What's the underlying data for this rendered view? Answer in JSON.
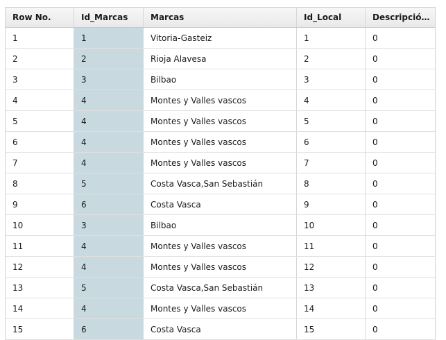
{
  "table": {
    "columns": [
      "Row No.",
      "Id_Marcas",
      "Marcas",
      "Id_Local",
      "Descripció…"
    ],
    "rows": [
      [
        "1",
        "1",
        "Vitoria-Gasteiz",
        "1",
        "0"
      ],
      [
        "2",
        "2",
        "Rioja Alavesa",
        "2",
        "0"
      ],
      [
        "3",
        "3",
        "Bilbao",
        "3",
        "0"
      ],
      [
        "4",
        "4",
        "Montes y Valles vascos",
        "4",
        "0"
      ],
      [
        "5",
        "4",
        "Montes y Valles vascos",
        "5",
        "0"
      ],
      [
        "6",
        "4",
        "Montes y Valles vascos",
        "6",
        "0"
      ],
      [
        "7",
        "4",
        "Montes y Valles vascos",
        "7",
        "0"
      ],
      [
        "8",
        "5",
        "Costa Vasca,San Sebastián",
        "8",
        "0"
      ],
      [
        "9",
        "6",
        "Costa Vasca",
        "9",
        "0"
      ],
      [
        "10",
        "3",
        "Bilbao",
        "10",
        "0"
      ],
      [
        "11",
        "4",
        "Montes y Valles vascos",
        "11",
        "0"
      ],
      [
        "12",
        "4",
        "Montes y Valles vascos",
        "12",
        "0"
      ],
      [
        "13",
        "5",
        "Costa Vasca,San Sebastián",
        "13",
        "0"
      ],
      [
        "14",
        "4",
        "Montes y Valles vascos",
        "14",
        "0"
      ],
      [
        "15",
        "6",
        "Costa Vasca",
        "15",
        "0"
      ]
    ],
    "selected_column_color": "#c9d9e0"
  }
}
